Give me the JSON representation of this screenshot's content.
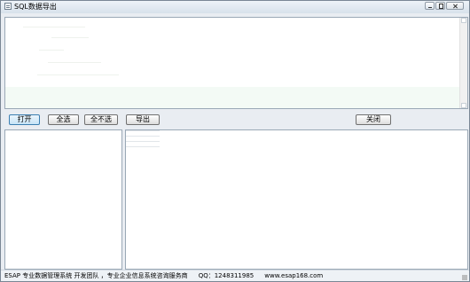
{
  "window": {
    "title": "SQL数据导出"
  },
  "toolbar": {
    "open_label": "打开",
    "select_all_label": "全选",
    "deselect_all_label": "全不选",
    "export_label": "导出",
    "close_label": "关闭"
  },
  "statusbar": {
    "text1": "ESAP 专业数据管理系统 开发团队 ，专业企业信息系统咨询服务商",
    "qq": "QQ：1248311985",
    "website": "www.esap168.com"
  },
  "icons": [
    "app-icon",
    "minimize-icon",
    "maximize-icon",
    "close-icon"
  ]
}
